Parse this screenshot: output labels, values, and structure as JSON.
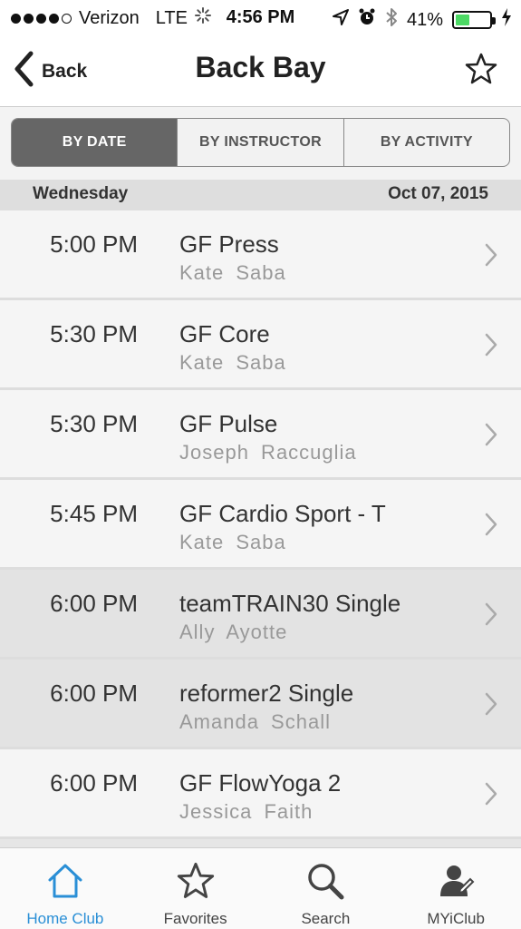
{
  "status_bar": {
    "carrier": "Verizon",
    "network": "LTE",
    "time": "4:56 PM",
    "battery": "41%",
    "battery_level": 0.41,
    "signal_bars_filled": 4,
    "signal_bars_total": 5
  },
  "nav": {
    "back_label": "Back",
    "title": "Back Bay"
  },
  "segments": [
    {
      "label": "BY DATE",
      "active": true
    },
    {
      "label": "BY INSTRUCTOR",
      "active": false
    },
    {
      "label": "BY ACTIVITY",
      "active": false
    }
  ],
  "date_header": {
    "day": "Wednesday",
    "date": "Oct 07, 2015"
  },
  "classes": [
    {
      "time": "5:00 PM",
      "name": "GF Press",
      "instructor": "Kate Saba"
    },
    {
      "time": "5:30 PM",
      "name": "GF Core",
      "instructor": "Kate Saba"
    },
    {
      "time": "5:30 PM",
      "name": "GF Pulse",
      "instructor": "Joseph Raccuglia"
    },
    {
      "time": "5:45 PM",
      "name": "GF Cardio Sport - T",
      "instructor": "Kate Saba"
    },
    {
      "time": "6:00 PM",
      "name": "teamTRAIN30 Single",
      "instructor": "Ally Ayotte"
    },
    {
      "time": "6:00 PM",
      "name": "reformer2 Single",
      "instructor": "Amanda Schall"
    },
    {
      "time": "6:00 PM",
      "name": "GF FlowYoga 2",
      "instructor": "Jessica Faith"
    }
  ],
  "tabs": [
    {
      "label": "Home Club",
      "icon": "home-icon",
      "active": true
    },
    {
      "label": "Favorites",
      "icon": "star-icon",
      "active": false
    },
    {
      "label": "Search",
      "icon": "search-icon",
      "active": false
    },
    {
      "label": "MYiClub",
      "icon": "profile-icon",
      "active": false
    }
  ],
  "colors": {
    "accent": "#2a8fd6",
    "segment_active": "#666666",
    "battery": "#4cd964"
  }
}
